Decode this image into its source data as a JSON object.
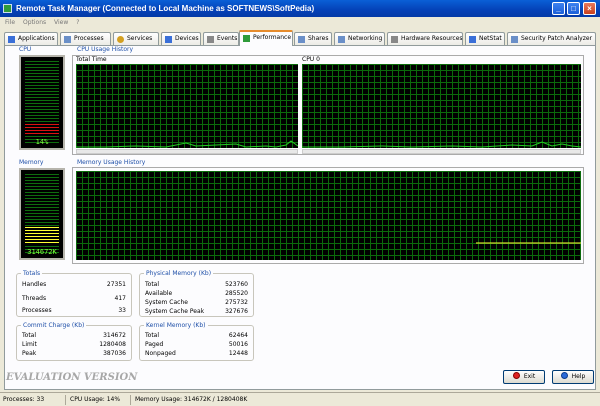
{
  "window": {
    "title": "Remote Task Manager (Connected to Local Machine as SOFTNEWS\\SoftPedia)"
  },
  "menu": [
    "File",
    "Options",
    "View",
    "?"
  ],
  "tabs": [
    {
      "label": "Applications",
      "icon": "applications-icon",
      "color": "#3a6fd8"
    },
    {
      "label": "Processes",
      "icon": "processes-icon",
      "color": "#6a8fc8"
    },
    {
      "label": "Services",
      "icon": "gear-icon",
      "color": "#d4a020"
    },
    {
      "label": "Devices",
      "icon": "devices-icon",
      "color": "#3a6fd8"
    },
    {
      "label": "Events",
      "icon": "events-icon",
      "color": "#888888"
    },
    {
      "label": "Performance",
      "icon": "performance-icon",
      "color": "#2f9b3a"
    },
    {
      "label": "Shares",
      "icon": "shares-icon",
      "color": "#6a8fc8"
    },
    {
      "label": "Networking",
      "icon": "networking-icon",
      "color": "#6a8fc8"
    },
    {
      "label": "Hardware Resources",
      "icon": "hardware-icon",
      "color": "#888888"
    },
    {
      "label": "NetStat",
      "icon": "netstat-icon",
      "color": "#3a6fd8"
    },
    {
      "label": "Security Patch Analyzer",
      "icon": "security-icon",
      "color": "#6a8fc8"
    }
  ],
  "active_tab": "Performance",
  "cpu": {
    "label": "CPU",
    "value": "14%",
    "percent": 14
  },
  "cpu_history": {
    "label": "CPU Usage History",
    "graphs": [
      "Total Time",
      "CPU 0"
    ]
  },
  "memory": {
    "label": "Memory",
    "value": "314672K",
    "fraction": 0.245
  },
  "memory_history": {
    "label": "Memory Usage History"
  },
  "totals": {
    "title": "Totals",
    "rows": [
      {
        "k": "Handles",
        "v": "27351"
      },
      {
        "k": "Threads",
        "v": "417"
      },
      {
        "k": "Processes",
        "v": "33"
      }
    ]
  },
  "physical_memory": {
    "title": "Physical Memory (Kb)",
    "rows": [
      {
        "k": "Total",
        "v": "523760"
      },
      {
        "k": "Available",
        "v": "285520"
      },
      {
        "k": "System Cache",
        "v": "275732"
      },
      {
        "k": "System Cache Peak",
        "v": "327676"
      }
    ]
  },
  "commit_charge": {
    "title": "Commit Charge (Kb)",
    "rows": [
      {
        "k": "Total",
        "v": "314672"
      },
      {
        "k": "Limit",
        "v": "1280408"
      },
      {
        "k": "Peak",
        "v": "387036"
      }
    ]
  },
  "kernel_memory": {
    "title": "Kernel Memory (Kb)",
    "rows": [
      {
        "k": "Total",
        "v": "62464"
      },
      {
        "k": "Paged",
        "v": "50016"
      },
      {
        "k": "Nonpaged",
        "v": "12448"
      }
    ]
  },
  "watermark": "EVALUATION VERSION",
  "buttons": {
    "exit": "Exit",
    "help": "Help"
  },
  "status": {
    "processes": "Processes: 33",
    "cpu": "CPU Usage: 14%",
    "memory": "Memory Usage: 314672K / 1280408K"
  },
  "colors": {
    "grid": "#0b6a0b",
    "cpu_line": "#22cc22",
    "mem_line": "#ffff33",
    "accent": "#1e4fa8"
  }
}
